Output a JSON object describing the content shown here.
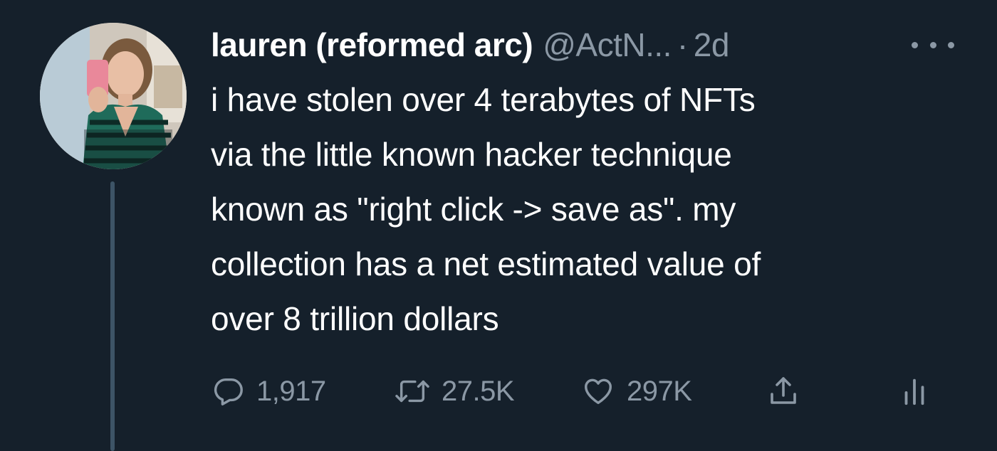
{
  "tweet": {
    "author": {
      "display_name": "lauren (reformed arc)",
      "handle": "@ActN...",
      "separator": "·",
      "time": "2d"
    },
    "text_lines": [
      "i have stolen over 4 terabytes of NFTs",
      "via the little known hacker technique",
      "known as \"right click -> save as\". my",
      "collection has a net estimated value of",
      "over 8 trillion dollars"
    ],
    "actions": {
      "reply": {
        "icon": "reply-icon",
        "count": "1,917"
      },
      "retweet": {
        "icon": "retweet-icon",
        "count": "27.5K"
      },
      "like": {
        "icon": "heart-icon",
        "count": "297K"
      },
      "share": {
        "icon": "share-icon"
      },
      "analytics": {
        "icon": "analytics-icon"
      }
    }
  },
  "colors": {
    "background": "#15202b",
    "primary_text": "#ffffff",
    "secondary_text": "#8b98a5",
    "thread_line": "#3d5466"
  }
}
